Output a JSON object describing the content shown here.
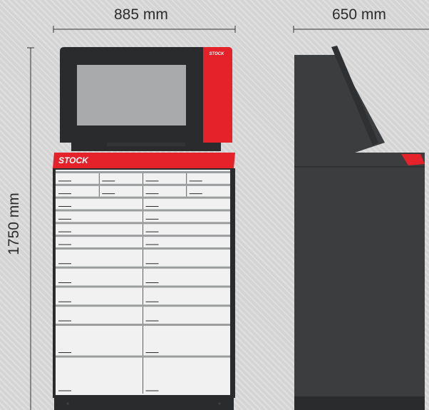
{
  "dimensions": {
    "width": "885 mm",
    "depth": "650 mm",
    "height": "1750 mm"
  },
  "brand": {
    "logo_text": "STOCK",
    "accent_color": "#e5222a",
    "body_color": "#3c3d3f",
    "frame_color": "#2a2b2d",
    "screen_color": "#a9aaab",
    "drawer_color": "#f1f1f1"
  },
  "drawer_rows": [
    {
      "cols": 4,
      "h": 1
    },
    {
      "cols": 4,
      "h": 1
    },
    {
      "cols": 2,
      "h": 1
    },
    {
      "cols": 2,
      "h": 1
    },
    {
      "cols": 2,
      "h": 1
    },
    {
      "cols": 2,
      "h": 1
    },
    {
      "cols": 2,
      "h": 1.5
    },
    {
      "cols": 2,
      "h": 1.5
    },
    {
      "cols": 2,
      "h": 1.5
    },
    {
      "cols": 2,
      "h": 1.5
    },
    {
      "cols": 2,
      "h": 2.5
    },
    {
      "cols": 2,
      "h": 3
    }
  ]
}
